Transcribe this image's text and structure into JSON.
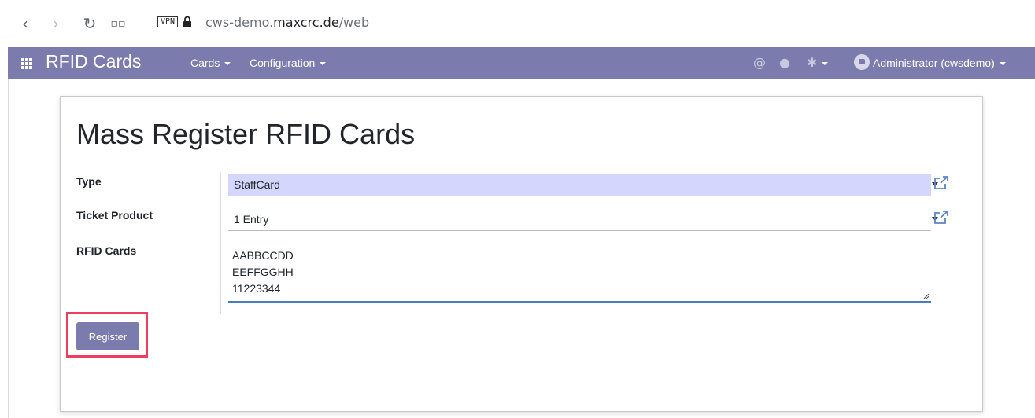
{
  "browser": {
    "url_host": "cws-demo.",
    "url_domain": "maxcrc.de",
    "url_path": "/web",
    "vpn_label": "VPN"
  },
  "navbar": {
    "brand": "RFID Cards",
    "menus": [
      "Cards",
      "Configuration"
    ],
    "user": "Administrator (cwsdemo)",
    "color": "#7c7bad"
  },
  "form": {
    "title": "Mass Register RFID Cards",
    "fields": [
      {
        "label": "Type",
        "value": "StaffCard"
      },
      {
        "label": "Ticket Product",
        "value": "1 Entry"
      },
      {
        "label": "RFID Cards",
        "lines": [
          "AABBCCDD",
          "EEFFGGHH",
          "11223344"
        ]
      }
    ],
    "register_label": "Register"
  },
  "colors": {
    "type_field_bg": "#d5d6fe",
    "highlight_border": "#ee3e5d",
    "textarea_focus": "#4a7ebb"
  }
}
